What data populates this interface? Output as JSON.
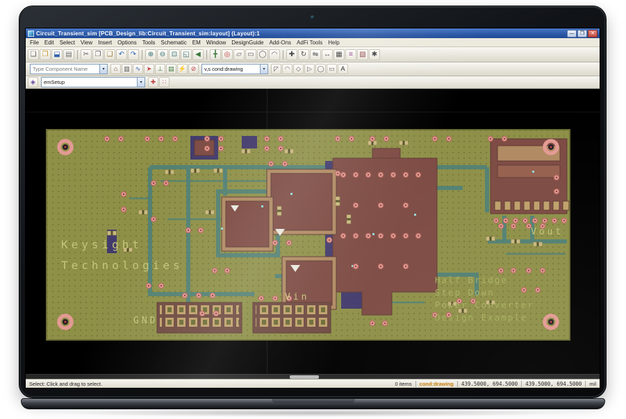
{
  "window": {
    "title": "Circuit_Transient_sim [PCB_Design_lib:Circuit_Transient_sim:layout] (Layout):1",
    "controls": {
      "minimize": "—",
      "maximize": "❐",
      "close": "✕"
    }
  },
  "menu": {
    "items": [
      "File",
      "Edit",
      "Select",
      "View",
      "Insert",
      "Options",
      "Tools",
      "Schematic",
      "EM",
      "Window",
      "DesignGuide",
      "Add-Ons",
      "AdFi Tools",
      "Help"
    ]
  },
  "toolbars": {
    "row1": {
      "icons": [
        {
          "name": "new-design-icon",
          "glyph": "❏",
          "color": "#5a5a5a"
        },
        {
          "name": "open-design-icon",
          "glyph": "❒",
          "color": "#c89020"
        },
        {
          "name": "save-design-icon",
          "glyph": "⬓",
          "color": "#2d5fae"
        },
        {
          "name": "print-icon",
          "glyph": "▤",
          "color": "#707070"
        },
        {
          "sep": true
        },
        {
          "name": "cut-icon",
          "glyph": "✂",
          "color": "#606060"
        },
        {
          "name": "copy-icon",
          "glyph": "❐",
          "color": "#606060"
        },
        {
          "name": "paste-icon",
          "glyph": "❑",
          "color": "#a07828"
        },
        {
          "name": "undo-icon",
          "glyph": "↶",
          "color": "#2d5fae"
        },
        {
          "name": "redo-icon",
          "glyph": "↷",
          "color": "#2d5fae"
        },
        {
          "sep": true
        },
        {
          "name": "zoom-in-icon",
          "glyph": "⊕",
          "color": "#2f6f6f"
        },
        {
          "name": "zoom-out-icon",
          "glyph": "⊖",
          "color": "#2f6f6f"
        },
        {
          "name": "zoom-area-icon",
          "glyph": "⊡",
          "color": "#2f6f6f"
        },
        {
          "name": "zoom-fit-icon",
          "glyph": "◱",
          "color": "#2f6f6f"
        },
        {
          "name": "view-last-icon",
          "glyph": "◀",
          "color": "#3d7a3d"
        },
        {
          "sep": true
        },
        {
          "name": "insert-trace-icon",
          "glyph": "╋",
          "color": "#3d7a3d"
        },
        {
          "name": "insert-via-icon",
          "glyph": "◎",
          "color": "#bf4040"
        },
        {
          "name": "insert-polygon-icon",
          "glyph": "▱",
          "color": "#555555"
        },
        {
          "name": "insert-rectangle-icon",
          "glyph": "▭",
          "color": "#555555"
        },
        {
          "name": "insert-circle-icon",
          "glyph": "◯",
          "color": "#555555"
        },
        {
          "name": "insert-arc-icon",
          "glyph": "◠",
          "color": "#555555"
        },
        {
          "sep": true
        },
        {
          "name": "move-icon",
          "glyph": "✚",
          "color": "#404040"
        },
        {
          "name": "rotate-icon",
          "glyph": "↻",
          "color": "#404040"
        },
        {
          "name": "mirror-icon",
          "glyph": "⇋",
          "color": "#404040"
        },
        {
          "name": "dimension-icon",
          "glyph": "↔",
          "color": "#404040"
        },
        {
          "name": "grid-icon",
          "glyph": "▦",
          "color": "#404040"
        },
        {
          "name": "layer-stack-icon",
          "glyph": "≡",
          "color": "#8a3d8a"
        },
        {
          "name": "em-simulation-icon",
          "glyph": "▧",
          "color": "#8a3d3d"
        },
        {
          "name": "preferences-icon",
          "glyph": "✱",
          "color": "#404040"
        }
      ]
    },
    "row2": {
      "component_combo": "Type Component Name",
      "layer_combo": "v,s  cond:drawing",
      "icons_a": [
        {
          "name": "component-palette-icon",
          "glyph": "⌂",
          "color": "#7a5230"
        },
        {
          "name": "component-list-icon",
          "glyph": "▥",
          "color": "#555555"
        },
        {
          "name": "net-highlight-icon",
          "glyph": "∿",
          "color": "#2d5fae"
        },
        {
          "name": "em-port-icon",
          "glyph": "➤",
          "color": "#bf4040"
        },
        {
          "name": "ground-pin-icon",
          "glyph": "⊥",
          "color": "#3d7a3d"
        },
        {
          "name": "substrate-stack-icon",
          "glyph": "▤",
          "color": "#3d7a3d"
        },
        {
          "name": "simulate-icon",
          "glyph": "⚡",
          "color": "#c89020"
        },
        {
          "name": "stop-icon",
          "glyph": "⊘",
          "color": "#bf4040"
        }
      ],
      "icons_b": [
        {
          "name": "corner-tool-icon",
          "glyph": "◸",
          "color": "#555555"
        },
        {
          "name": "arc-corner-icon",
          "glyph": "◠",
          "color": "#555555"
        },
        {
          "name": "diamond-tool-icon",
          "glyph": "◇",
          "color": "#555555"
        },
        {
          "name": "pentagon-tool-icon",
          "glyph": "▷",
          "color": "#555555"
        },
        {
          "name": "ellipse-tool-icon",
          "glyph": "◯",
          "color": "#555555"
        },
        {
          "name": "rect-tool-icon",
          "glyph": "▭",
          "color": "#555555"
        },
        {
          "name": "text-tool-icon",
          "glyph": "A",
          "color": "#111111"
        }
      ]
    },
    "row3": {
      "em_combo": "emSetup",
      "icons_left": [
        {
          "name": "em-setup-icon",
          "glyph": "◈",
          "color": "#6040a0"
        }
      ],
      "icons_right": [
        {
          "name": "snap-origin-icon",
          "glyph": "✚",
          "color": "#bf4040"
        },
        {
          "name": "mesh-grid-icon",
          "glyph": "∷",
          "color": "#bf4040"
        }
      ]
    }
  },
  "board": {
    "brand_line1": "Keysight",
    "brand_line2": "Technologies",
    "label_gnd": "GND",
    "label_vin": "Vin",
    "label_vout": "Vout",
    "desc_line1": "Half Bridge",
    "desc_line2": "Step Down",
    "desc_line3": "Power Converter",
    "desc_line4": "Design Example",
    "colors": {
      "board": "#8e9048",
      "dot": "#6e7030",
      "copper": "#7d4b43",
      "copper_light": "#b08a62",
      "trace": "#4e8077",
      "purple": "#3d3470",
      "via": "#e39a92",
      "via_ring": "#b96a61",
      "pad": "#bfa06a",
      "text_bright": "#c4c57a",
      "text_dim": "#a8b060"
    }
  },
  "statusbar": {
    "hint": "Select: Click and drag to select.",
    "items_count": "0 items",
    "layer": "cond:drawing",
    "coord_a": "439.5000, 694.5000",
    "coord_b": "439.5000, 694.5000",
    "units": "mil"
  }
}
